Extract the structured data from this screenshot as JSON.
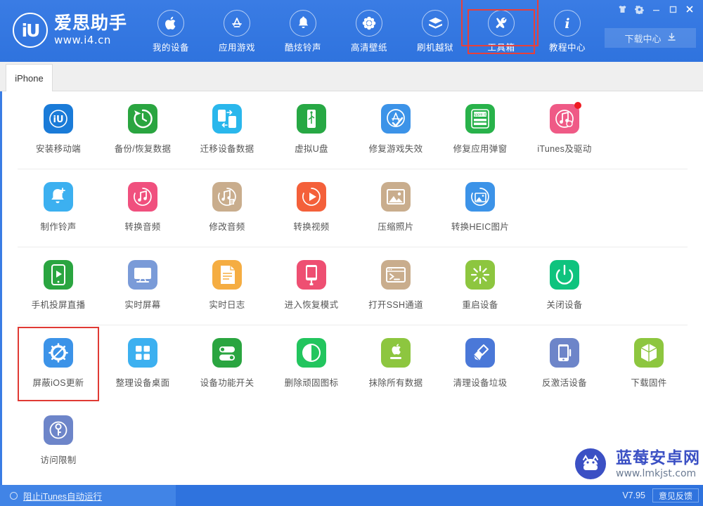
{
  "brand": {
    "mark": "iU",
    "title": "爱思助手",
    "url": "www.i4.cn"
  },
  "window_controls": [
    {
      "name": "skin-icon",
      "glyph": "skin"
    },
    {
      "name": "settings-gear-icon",
      "glyph": "gear"
    },
    {
      "name": "minimize-icon",
      "glyph": "minimize"
    },
    {
      "name": "maximize-icon",
      "glyph": "maximize"
    },
    {
      "name": "close-icon",
      "glyph": "close"
    }
  ],
  "nav": {
    "items": [
      {
        "label": "我的设备",
        "icon": "apple-icon",
        "selected": false
      },
      {
        "label": "应用游戏",
        "icon": "appstore-icon",
        "selected": false
      },
      {
        "label": "酷炫铃声",
        "icon": "bell-icon",
        "selected": false
      },
      {
        "label": "高清壁纸",
        "icon": "flower-icon",
        "selected": false
      },
      {
        "label": "刷机越狱",
        "icon": "box-open-icon",
        "selected": false
      },
      {
        "label": "工具箱",
        "icon": "tools-icon",
        "selected": true
      },
      {
        "label": "教程中心",
        "icon": "info-icon",
        "selected": false
      }
    ]
  },
  "download_center": {
    "label": "下载中心",
    "icon": "download-icon"
  },
  "tabs": [
    {
      "label": "iPhone",
      "active": true
    }
  ],
  "accent": {
    "header_blue": "#2f73de",
    "highlight_red": "#e03a34",
    "footer_blue": "#2f73de"
  },
  "tool_rows": [
    [
      {
        "label": "安装移动端",
        "icon": "i4-app-icon",
        "bg": "#1a7bd8",
        "badge": false
      },
      {
        "label": "备份/恢复数据",
        "icon": "backup-restore-icon",
        "bg": "#2aa540",
        "badge": false
      },
      {
        "label": "迁移设备数据",
        "icon": "device-migrate-icon",
        "bg": "#2ab7ec",
        "badge": false
      },
      {
        "label": "虚拟U盘",
        "icon": "usb-drive-icon",
        "bg": "#27a844",
        "badge": false
      },
      {
        "label": "修复游戏失效",
        "icon": "appstore-fix-icon",
        "bg": "#3c93e8",
        "badge": false
      },
      {
        "label": "修复应用弹窗",
        "icon": "apple-id-icon",
        "bg": "#28b24a",
        "badge": false
      },
      {
        "label": "iTunes及驱动",
        "icon": "itunes-driver-icon",
        "bg": "#ef5a86",
        "badge": true
      }
    ],
    [
      {
        "label": "制作铃声",
        "icon": "make-ringtone-icon",
        "bg": "#3cb0f0",
        "badge": false
      },
      {
        "label": "转换音频",
        "icon": "convert-audio-icon",
        "bg": "#f0507e",
        "badge": false
      },
      {
        "label": "修改音频",
        "icon": "edit-audio-icon",
        "bg": "#c9ad8d",
        "badge": false
      },
      {
        "label": "转换视频",
        "icon": "convert-video-icon",
        "bg": "#f4603a",
        "badge": false
      },
      {
        "label": "压缩照片",
        "icon": "compress-photo-icon",
        "bg": "#c9ad8d",
        "badge": false
      },
      {
        "label": "转换HEIC图片",
        "icon": "convert-heic-icon",
        "bg": "#3c93e8",
        "badge": false
      }
    ],
    [
      {
        "label": "手机投屏直播",
        "icon": "screen-cast-icon",
        "bg": "#2aa540",
        "badge": false
      },
      {
        "label": "实时屏幕",
        "icon": "realtime-screen-icon",
        "bg": "#7a9bd8",
        "badge": false
      },
      {
        "label": "实时日志",
        "icon": "realtime-log-icon",
        "bg": "#f5ad42",
        "badge": false
      },
      {
        "label": "进入恢复模式",
        "icon": "recovery-mode-icon",
        "bg": "#ee4f72",
        "badge": false
      },
      {
        "label": "打开SSH通道",
        "icon": "ssh-terminal-icon",
        "bg": "#c9ad8d",
        "badge": false
      },
      {
        "label": "重启设备",
        "icon": "restart-device-icon",
        "bg": "#8dc63f",
        "badge": false
      },
      {
        "label": "关闭设备",
        "icon": "power-off-icon",
        "bg": "#0fc37e",
        "badge": false
      }
    ],
    [
      {
        "label": "屏蔽iOS更新",
        "icon": "block-ios-update-icon",
        "bg": "#3c93e8",
        "badge": false,
        "selected": true
      },
      {
        "label": "整理设备桌面",
        "icon": "organize-desktop-icon",
        "bg": "#3cb0f0",
        "badge": false
      },
      {
        "label": "设备功能开关",
        "icon": "feature-toggle-icon",
        "bg": "#2aa540",
        "badge": false
      },
      {
        "label": "删除顽固图标",
        "icon": "delete-icon-icon",
        "bg": "#22c55e",
        "badge": false
      },
      {
        "label": "抹除所有数据",
        "icon": "erase-all-data-icon",
        "bg": "#8dc63f",
        "badge": false
      },
      {
        "label": "清理设备垃圾",
        "icon": "clean-junk-icon",
        "bg": "#4a78d8",
        "badge": false
      },
      {
        "label": "反激活设备",
        "icon": "deactivate-device-icon",
        "bg": "#6d85c9",
        "badge": false
      },
      {
        "label": "下载固件",
        "icon": "download-firmware-icon",
        "bg": "#8dc63f",
        "badge": false
      }
    ],
    [
      {
        "label": "访问限制",
        "icon": "access-restriction-icon",
        "bg": "#6d85c9",
        "badge": false
      }
    ]
  ],
  "footer": {
    "block_itunes_label": "阻止iTunes自动运行",
    "version": "V7.95",
    "feedback_label": "意见反馈"
  },
  "watermark": {
    "title": "蓝莓安卓网",
    "url": "www.lmkjst.com"
  }
}
